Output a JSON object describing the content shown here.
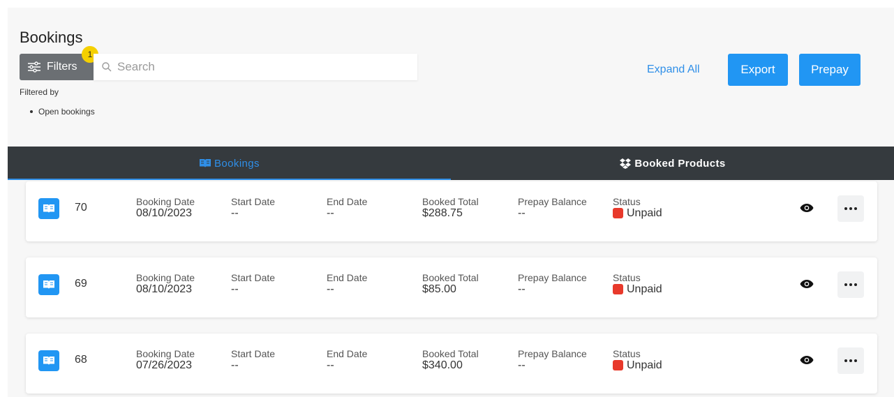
{
  "header": {
    "title": "Bookings",
    "filters_label": "Filters",
    "filter_count": "1",
    "search_placeholder": "Search",
    "filtered_by_label": "Filtered by",
    "active_filters": [
      "Open bookings"
    ],
    "expand_all_label": "Expand All",
    "export_label": "Export",
    "prepay_label": "Prepay"
  },
  "tabs": [
    {
      "label": "Bookings",
      "icon": "book-open-icon",
      "active": true
    },
    {
      "label": "Booked Products",
      "icon": "dropbox-icon",
      "active": false
    }
  ],
  "columns": {
    "booking_date": "Booking Date",
    "start_date": "Start Date",
    "end_date": "End Date",
    "booked_total": "Booked Total",
    "prepay_balance": "Prepay Balance",
    "status": "Status"
  },
  "bookings": [
    {
      "id": "70",
      "booking_date": "08/10/2023",
      "start_date": "--",
      "end_date": "--",
      "booked_total": "$288.75",
      "prepay_balance": "--",
      "status": "Unpaid"
    },
    {
      "id": "69",
      "booking_date": "08/10/2023",
      "start_date": "--",
      "end_date": "--",
      "booked_total": "$85.00",
      "prepay_balance": "--",
      "status": "Unpaid"
    },
    {
      "id": "68",
      "booking_date": "07/26/2023",
      "start_date": "--",
      "end_date": "--",
      "booked_total": "$340.00",
      "prepay_balance": "--",
      "status": "Unpaid"
    }
  ],
  "colors": {
    "accent": "#2196f3",
    "tab_bar": "#353a3e",
    "status_unpaid": "#e8392b",
    "badge": "#f5d000"
  }
}
